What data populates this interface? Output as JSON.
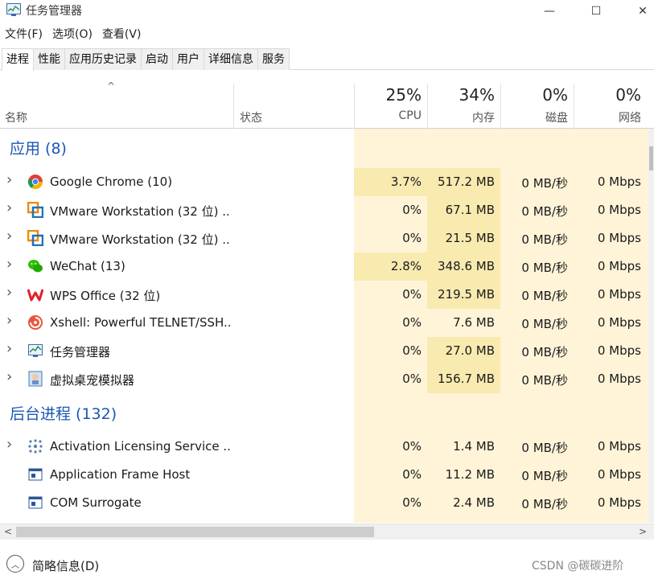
{
  "window": {
    "title": "任务管理器",
    "icon": "task-manager-icon"
  },
  "titlebar_buttons": {
    "minimize": "—",
    "maximize": "☐",
    "close": "✕"
  },
  "menu": [
    "文件(F)",
    "选项(O)",
    "查看(V)"
  ],
  "tabs": [
    "进程",
    "性能",
    "应用历史记录",
    "启动",
    "用户",
    "详细信息",
    "服务"
  ],
  "active_tab": "进程",
  "columns": {
    "name": "名称",
    "status": "状态",
    "cpu": {
      "pct": "25%",
      "label": "CPU"
    },
    "memory": {
      "pct": "34%",
      "label": "内存"
    },
    "disk": {
      "pct": "0%",
      "label": "磁盘"
    },
    "network": {
      "pct": "0%",
      "label": "网络"
    }
  },
  "groups": {
    "apps": "应用 (8)",
    "background": "后台进程 (132)"
  },
  "apps": [
    {
      "name": "Google Chrome (10)",
      "icon": "chrome-icon",
      "cpu": "3.7%",
      "mem": "517.2 MB",
      "disk": "0 MB/秒",
      "net": "0 Mbps"
    },
    {
      "name": "VMware Workstation (32 位) ...",
      "icon": "vmware-icon",
      "cpu": "0%",
      "mem": "67.1 MB",
      "disk": "0 MB/秒",
      "net": "0 Mbps"
    },
    {
      "name": "VMware Workstation (32 位) ...",
      "icon": "vmware-icon",
      "cpu": "0%",
      "mem": "21.5 MB",
      "disk": "0 MB/秒",
      "net": "0 Mbps"
    },
    {
      "name": "WeChat (13)",
      "icon": "wechat-icon",
      "cpu": "2.8%",
      "mem": "348.6 MB",
      "disk": "0 MB/秒",
      "net": "0 Mbps"
    },
    {
      "name": "WPS Office (32 位)",
      "icon": "wps-icon",
      "cpu": "0%",
      "mem": "219.5 MB",
      "disk": "0 MB/秒",
      "net": "0 Mbps"
    },
    {
      "name": "Xshell: Powerful TELNET/SSH...",
      "icon": "xshell-icon",
      "cpu": "0%",
      "mem": "7.6 MB",
      "disk": "0 MB/秒",
      "net": "0 Mbps"
    },
    {
      "name": "任务管理器",
      "icon": "task-manager-icon",
      "cpu": "0%",
      "mem": "27.0 MB",
      "disk": "0 MB/秒",
      "net": "0 Mbps"
    },
    {
      "name": "虚拟桌宠模拟器",
      "icon": "desktop-pet-icon",
      "cpu": "0%",
      "mem": "156.7 MB",
      "disk": "0 MB/秒",
      "net": "0 Mbps"
    }
  ],
  "background": [
    {
      "name": "Activation Licensing Service ...",
      "icon": "activation-icon",
      "cpu": "0%",
      "mem": "1.4 MB",
      "disk": "0 MB/秒",
      "net": "0 Mbps",
      "expandable": true
    },
    {
      "name": "Application Frame Host",
      "icon": "app-window-icon",
      "cpu": "0%",
      "mem": "11.2 MB",
      "disk": "0 MB/秒",
      "net": "0 Mbps",
      "expandable": false
    },
    {
      "name": "COM Surrogate",
      "icon": "app-window-icon",
      "cpu": "0%",
      "mem": "2.4 MB",
      "disk": "0 MB/秒",
      "net": "0 Mbps",
      "expandable": false
    }
  ],
  "footer": {
    "fewer_details": "简略信息(D)",
    "watermark": "CSDN @碳碳进阶"
  },
  "colors": {
    "heat_light": "#fff4d8",
    "heat_mid": "#f9eab0",
    "group_blue": "#1b57b3"
  }
}
